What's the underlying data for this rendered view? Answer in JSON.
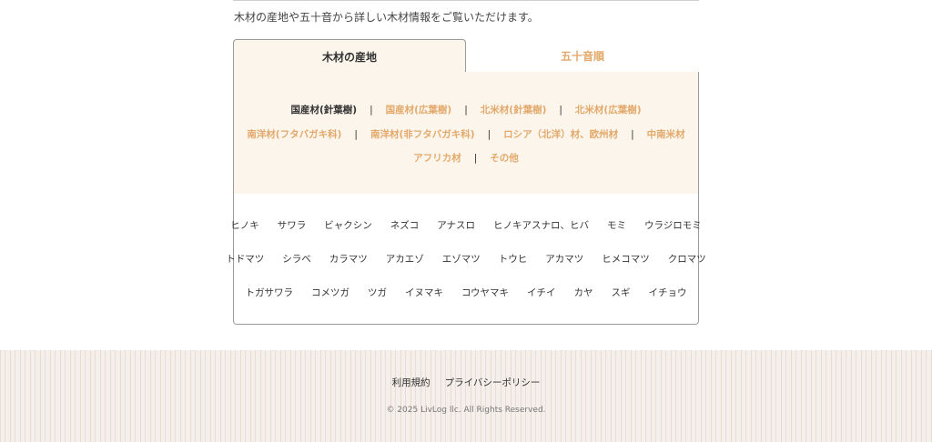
{
  "intro": "木材の産地や五十音から詳しい木材情報をご覧いただけます。",
  "tabs": [
    {
      "label": "木材の産地",
      "active": true
    },
    {
      "label": "五十音順",
      "active": false
    }
  ],
  "regions": [
    [
      "国産材(針葉樹)",
      "国産材(広葉樹)",
      "北米材(針葉樹)",
      "北米材(広葉樹)"
    ],
    [
      "南洋材(フタバガキ科)",
      "南洋材(非フタバガキ科)",
      "ロシア（北洋）材、欧州材",
      "中南米材"
    ],
    [
      "アフリカ材",
      "その他"
    ]
  ],
  "separator": "|",
  "species": [
    [
      "ヒノキ",
      "サワラ",
      "ビャクシン",
      "ネズコ",
      "アナスロ",
      "ヒノキアスナロ、ヒバ",
      "モミ",
      "ウラジロモミ"
    ],
    [
      "トドマツ",
      "シラベ",
      "カラマツ",
      "アカエゾ",
      "エゾマツ",
      "トウヒ",
      "アカマツ",
      "ヒメコマツ",
      "クロマツ"
    ],
    [
      "トガサワラ",
      "コメツガ",
      "ツガ",
      "イヌマキ",
      "コウヤマキ",
      "イチイ",
      "カヤ",
      "スギ",
      "イチョウ"
    ]
  ],
  "footer": {
    "links": [
      "利用規約",
      "プライバシーポリシー"
    ],
    "copyright": "© 2025 LivLog llc. All Rights Reserved."
  },
  "colors": {
    "accent": "#e3a96b",
    "panel_bg": "#fcf5ec",
    "border": "#9d9a9a"
  }
}
